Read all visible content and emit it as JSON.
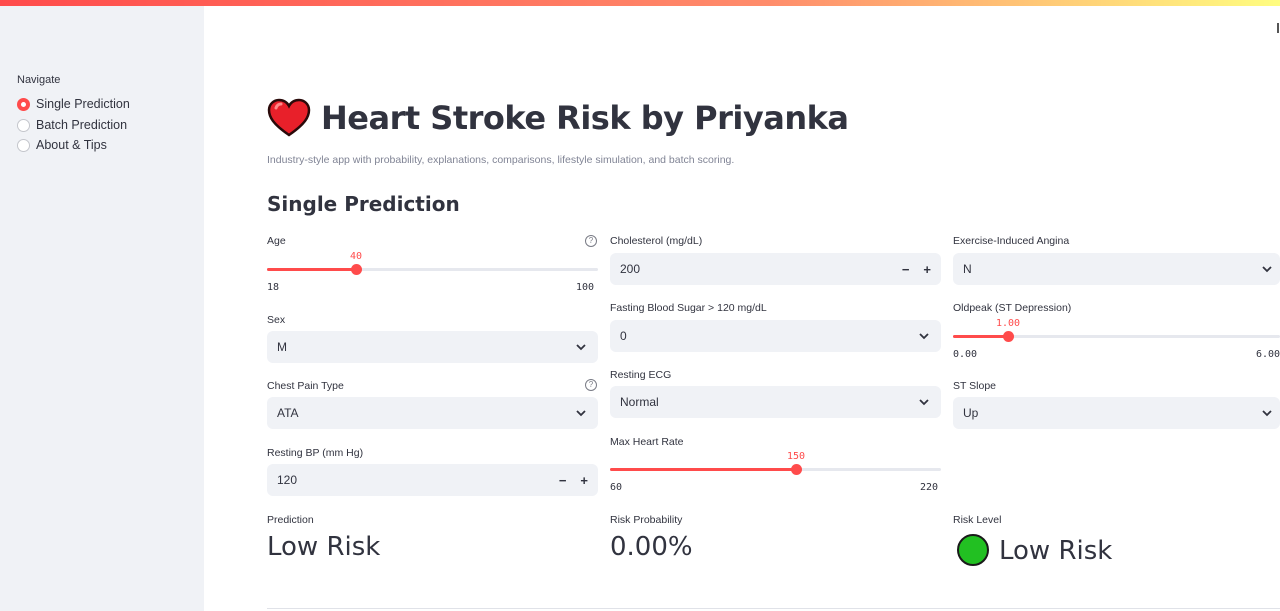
{
  "sidebar": {
    "label": "Navigate",
    "items": [
      {
        "label": "Single Prediction",
        "selected": true
      },
      {
        "label": "Batch Prediction",
        "selected": false
      },
      {
        "label": "About & Tips",
        "selected": false
      }
    ]
  },
  "header": {
    "emoji": "heart-emoji",
    "title": "Heart Stroke Risk by Priyanka",
    "subtitle": "Industry-style app with probability, explanations, comparisons, lifestyle simulation, and batch scoring."
  },
  "section_title": "Single Prediction",
  "form": {
    "age": {
      "label": "Age",
      "value": "40",
      "min": "18",
      "max": "100",
      "fraction": 0.268
    },
    "sex": {
      "label": "Sex",
      "value": "M"
    },
    "chest_pain": {
      "label": "Chest Pain Type",
      "value": "ATA"
    },
    "resting_bp": {
      "label": "Resting BP (mm Hg)",
      "value": "120"
    },
    "cholesterol": {
      "label": "Cholesterol (mg/dL)",
      "value": "200"
    },
    "fasting_bs": {
      "label": "Fasting Blood Sugar > 120 mg/dL",
      "value": "0"
    },
    "resting_ecg": {
      "label": "Resting ECG",
      "value": "Normal"
    },
    "max_hr": {
      "label": "Max Heart Rate",
      "value": "150",
      "min": "60",
      "max": "220",
      "fraction": 0.5625
    },
    "exercise_angina": {
      "label": "Exercise-Induced Angina",
      "value": "N"
    },
    "oldpeak": {
      "label": "Oldpeak (ST Depression)",
      "value": "1.00",
      "min": "0.00",
      "max": "6.00",
      "fraction": 0.1667
    },
    "st_slope": {
      "label": "ST Slope",
      "value": "Up"
    }
  },
  "results": {
    "prediction": {
      "label": "Prediction",
      "value": "Low Risk"
    },
    "probability": {
      "label": "Risk Probability",
      "value": "0.00%"
    },
    "risk_level": {
      "label": "Risk Level",
      "value": "Low Risk",
      "color": "#22c022"
    }
  },
  "colors": {
    "accent": "#ff4b4b",
    "sidebar_bg": "#f0f2f6"
  },
  "icons": {
    "help": "question-circle-icon",
    "dropdown": "chevron-down-icon"
  }
}
